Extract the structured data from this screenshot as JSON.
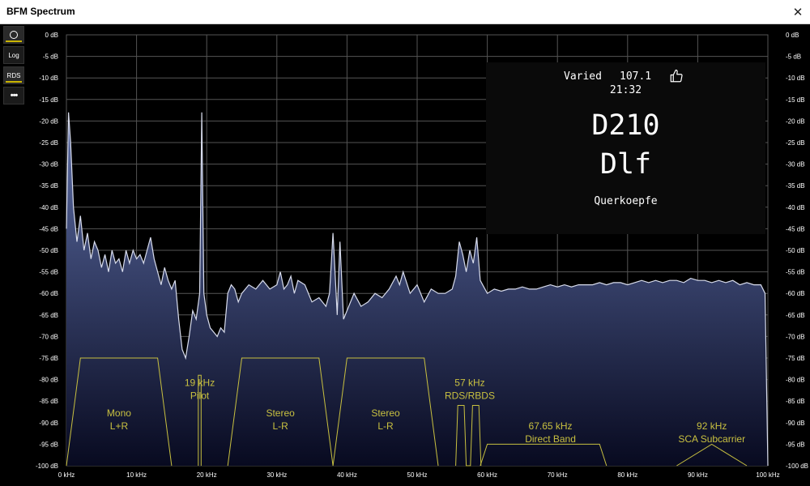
{
  "window": {
    "title": "BFM Spectrum",
    "close_label": "✕"
  },
  "toolbar": [
    {
      "name": "record-button",
      "label": "",
      "icon": "circle-icon",
      "active": true
    },
    {
      "name": "log-button",
      "label": "Log",
      "icon": "",
      "active": false
    },
    {
      "name": "rds-button",
      "label": "RDS",
      "icon": "",
      "active": true
    },
    {
      "name": "more-button",
      "label": "•••",
      "icon": "more-icon",
      "active": false
    }
  ],
  "rds": {
    "pty": "Varied",
    "frequency": "107.1",
    "time": "21:32",
    "pi": "D210",
    "ps": "Dlf",
    "radiotext": "Querkoepfe",
    "icon": "thumbs-up-icon"
  },
  "colors": {
    "trace": "#d8dcec",
    "fill_top": "#5e6fa8",
    "fill_bottom": "#080a20",
    "bands": "#c8c040",
    "grid": "#555555",
    "ticks": "#ffffff"
  },
  "chart_data": {
    "type": "area",
    "xlabel": "",
    "ylabel": "",
    "xlim": [
      0,
      100
    ],
    "ylim": [
      -100,
      0
    ],
    "x_ticks": [
      "0 kHz",
      "10 kHz",
      "20 kHz",
      "30 kHz",
      "40 kHz",
      "50 kHz",
      "60 kHz",
      "70 kHz",
      "80 kHz",
      "90 kHz",
      "100 kHz"
    ],
    "y_ticks": [
      "0 dB",
      "-5 dB",
      "-10 dB",
      "-15 dB",
      "-20 dB",
      "-25 dB",
      "-30 dB",
      "-35 dB",
      "-40 dB",
      "-45 dB",
      "-50 dB",
      "-55 dB",
      "-60 dB",
      "-65 dB",
      "-70 dB",
      "-75 dB",
      "-80 dB",
      "-85 dB",
      "-90 dB",
      "-95 dB",
      "-100 dB"
    ],
    "grid": true,
    "series": [
      {
        "x": [
          0,
          0.3,
          0.6,
          1,
          1.5,
          2,
          2.5,
          3,
          3.5,
          4,
          4.5,
          5,
          5.5,
          6,
          6.5,
          7,
          7.5,
          8,
          8.5,
          9,
          9.5,
          10,
          10.5,
          11,
          11.5,
          12,
          12.5,
          13,
          13.5,
          14,
          14.5,
          15,
          15.5,
          16,
          16.5,
          17,
          17.5,
          18,
          18.5,
          19,
          19.3,
          19.6,
          20,
          20.5,
          21,
          21.5,
          22,
          22.5,
          23,
          23.5,
          24,
          24.5,
          25,
          26,
          27,
          28,
          29,
          30,
          30.5,
          31,
          31.5,
          32,
          32.5,
          33,
          34,
          35,
          36,
          37,
          37.5,
          37.8,
          38,
          38.2,
          38.6,
          39,
          39.5,
          40,
          41,
          42,
          43,
          44,
          45,
          46,
          47,
          47.5,
          48,
          49,
          50,
          51,
          52,
          53,
          54,
          55,
          55.5,
          56,
          56.5,
          57,
          57.5,
          58,
          58.5,
          59,
          60,
          61,
          62,
          63,
          64,
          65,
          66,
          67,
          68,
          69,
          70,
          71,
          72,
          73,
          74,
          75,
          76,
          77,
          78,
          79,
          80,
          81,
          82,
          83,
          84,
          85,
          86,
          87,
          88,
          89,
          90,
          91,
          92,
          93,
          94,
          95,
          96,
          97,
          98,
          99,
          99.6,
          100
        ],
        "y": [
          -45,
          -18,
          -25,
          -40,
          -48,
          -42,
          -50,
          -46,
          -52,
          -48,
          -50,
          -54,
          -51,
          -55,
          -50,
          -53,
          -52,
          -55,
          -50,
          -53,
          -50,
          -52,
          -51,
          -53,
          -50,
          -47,
          -52,
          -55,
          -58,
          -54,
          -57,
          -59,
          -57,
          -66,
          -73,
          -75,
          -70,
          -64,
          -66,
          -60,
          -18,
          -60,
          -65,
          -68,
          -69,
          -70,
          -68,
          -69,
          -60,
          -58,
          -59,
          -62,
          -60,
          -58,
          -59,
          -57,
          -59,
          -58,
          -55,
          -59,
          -58,
          -56,
          -60,
          -57,
          -58,
          -62,
          -61,
          -63,
          -60,
          -52,
          -46,
          -52,
          -65,
          -48,
          -66,
          -64,
          -60,
          -63,
          -62,
          -60,
          -61,
          -59,
          -56,
          -58,
          -55,
          -60,
          -58,
          -62,
          -59,
          -60,
          -60,
          -59,
          -56,
          -48,
          -51,
          -55,
          -50,
          -53,
          -47,
          -57,
          -60,
          -59,
          -59.5,
          -59,
          -59,
          -58.5,
          -59,
          -59,
          -58.5,
          -58,
          -58.5,
          -58,
          -58.5,
          -58,
          -58,
          -58,
          -57.5,
          -58,
          -57.5,
          -57.5,
          -58,
          -57.5,
          -57,
          -57.5,
          -57,
          -57.5,
          -57,
          -57,
          -57.5,
          -56.5,
          -57,
          -57,
          -57.5,
          -57,
          -57.5,
          -57,
          -58,
          -57.5,
          -58,
          -58,
          -60,
          -100
        ]
      }
    ],
    "annotations": [
      {
        "text": [
          "Mono",
          "L+R"
        ],
        "x": 7.5,
        "y": -88.5,
        "shape": [
          [
            0,
            -100
          ],
          [
            2,
            -75
          ],
          [
            13,
            -75
          ],
          [
            15,
            -100
          ]
        ]
      },
      {
        "text": [
          "19 kHz",
          "Pilot"
        ],
        "x": 19,
        "y": -81.5,
        "shape": [
          [
            18.8,
            -100
          ],
          [
            18.8,
            -79
          ],
          [
            19.2,
            -79
          ],
          [
            19.2,
            -100
          ]
        ]
      },
      {
        "text": [
          "Stereo",
          "L-R"
        ],
        "x": 30.5,
        "y": -88.5,
        "shape": [
          [
            23,
            -100
          ],
          [
            25,
            -75
          ],
          [
            36,
            -75
          ],
          [
            38,
            -100
          ]
        ]
      },
      {
        "text": [
          "Stereo",
          "L-R"
        ],
        "x": 45.5,
        "y": -88.5,
        "shape": [
          [
            38,
            -100
          ],
          [
            40,
            -75
          ],
          [
            51,
            -75
          ],
          [
            53,
            -100
          ]
        ]
      },
      {
        "text": [
          "57 kHz",
          "RDS/RBDS"
        ],
        "x": 57.5,
        "y": -81.5,
        "shape": [
          [
            55.5,
            -100
          ],
          [
            55.8,
            -86
          ],
          [
            56.7,
            -86
          ],
          [
            57,
            -100
          ],
          [
            57.6,
            -100
          ],
          [
            57.9,
            -86
          ],
          [
            58.8,
            -86
          ],
          [
            59.1,
            -100
          ]
        ]
      },
      {
        "text": [
          "67.65 kHz",
          "Direct Band"
        ],
        "x": 69,
        "y": -91.5,
        "shape": [
          [
            59,
            -100
          ],
          [
            60,
            -95
          ],
          [
            76,
            -95
          ],
          [
            77,
            -100
          ]
        ]
      },
      {
        "text": [
          "92 kHz",
          "SCA Subcarrier"
        ],
        "x": 92,
        "y": -91.5,
        "shape": [
          [
            87,
            -100
          ],
          [
            92,
            -95
          ],
          [
            97,
            -100
          ]
        ]
      }
    ]
  }
}
